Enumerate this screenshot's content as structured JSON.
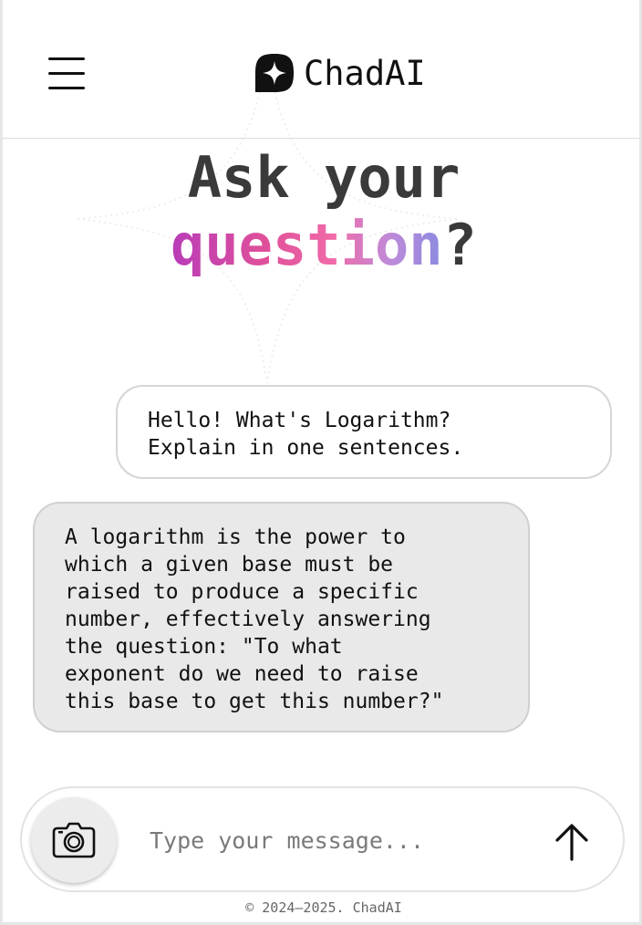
{
  "header": {
    "menu_icon": "hamburger-menu-icon",
    "logo_icon": "sparkle-star-logo-icon",
    "brand_name": "ChadAI"
  },
  "hero": {
    "line1": "Ask your",
    "highlight": "question",
    "suffix": "?"
  },
  "messages": [
    {
      "role": "user",
      "text": "Hello! What's Logarithm?\nExplain in one sentences."
    },
    {
      "role": "assistant",
      "text": "A logarithm is the power to\nwhich a given base must be\nraised to produce a specific\nnumber, effectively answering\nthe question: \"To what\nexponent do we need to raise\nthis base to get this number?\""
    }
  ],
  "composer": {
    "camera_icon": "camera-icon",
    "placeholder": "Type your message...",
    "value": "",
    "send_icon": "arrow-up-icon"
  },
  "footer": {
    "copyright": "© 2024–2025. ChadAI"
  },
  "colors": {
    "gradient_start": "#b83cb8",
    "gradient_mid": "#f06aa8",
    "gradient_end": "#8a8ae0",
    "assistant_bubble_bg": "#e9e9e9",
    "hero_text": "#3a3a3a"
  }
}
